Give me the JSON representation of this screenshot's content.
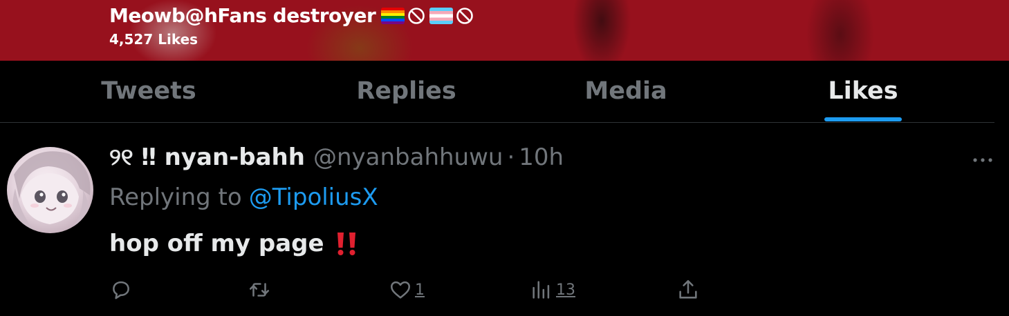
{
  "header": {
    "display_name": "Meowb@hFans destroyer",
    "likes_count": "4,527 Likes",
    "banner_color": "#97111d"
  },
  "tabs": [
    {
      "label": "Tweets",
      "active": false
    },
    {
      "label": "Replies",
      "active": false
    },
    {
      "label": "Media",
      "active": false
    },
    {
      "label": "Likes",
      "active": true
    }
  ],
  "accent_color": "#1d9bf0",
  "tweet": {
    "author_name": "୨୧ ‼ nyan-bahh",
    "author_handle": "@nyanbahhuwu",
    "separator": "·",
    "time": "10h",
    "reply_prefix": "Replying to",
    "reply_to": "@TipoliusX",
    "text": "hop off my page",
    "actions": {
      "reply": {
        "icon": "reply-icon",
        "count": ""
      },
      "retweet": {
        "icon": "retweet-icon",
        "count": ""
      },
      "like": {
        "icon": "heart-icon",
        "count": "1"
      },
      "views": {
        "icon": "views-icon",
        "count": "13"
      },
      "share": {
        "icon": "share-icon",
        "count": ""
      }
    }
  }
}
